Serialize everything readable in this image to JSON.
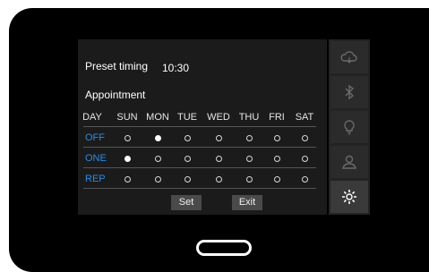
{
  "preset": {
    "label": "Preset timing",
    "time": "10:30"
  },
  "appointment": {
    "label": "Appointment"
  },
  "header": {
    "day_label": "DAY",
    "days": [
      "SUN",
      "MON",
      "TUE",
      "WED",
      "THU",
      "FRI",
      "SAT"
    ]
  },
  "rows": [
    {
      "label": "OFF",
      "selected": [
        false,
        true,
        false,
        false,
        false,
        false,
        false
      ]
    },
    {
      "label": "ONE",
      "selected": [
        true,
        false,
        false,
        false,
        false,
        false,
        false
      ]
    },
    {
      "label": "REP",
      "selected": [
        false,
        false,
        false,
        false,
        false,
        false,
        false
      ]
    }
  ],
  "buttons": {
    "set": "Set",
    "exit": "Exit"
  },
  "sidebar": {
    "items": [
      "cloud-icon",
      "bluetooth-icon",
      "bulb-icon",
      "person-icon",
      "gear-icon"
    ],
    "active": "gear-icon"
  },
  "colors": {
    "accent": "#2a8be0",
    "screen": "#1b1b1b",
    "bezel": "#000000"
  }
}
